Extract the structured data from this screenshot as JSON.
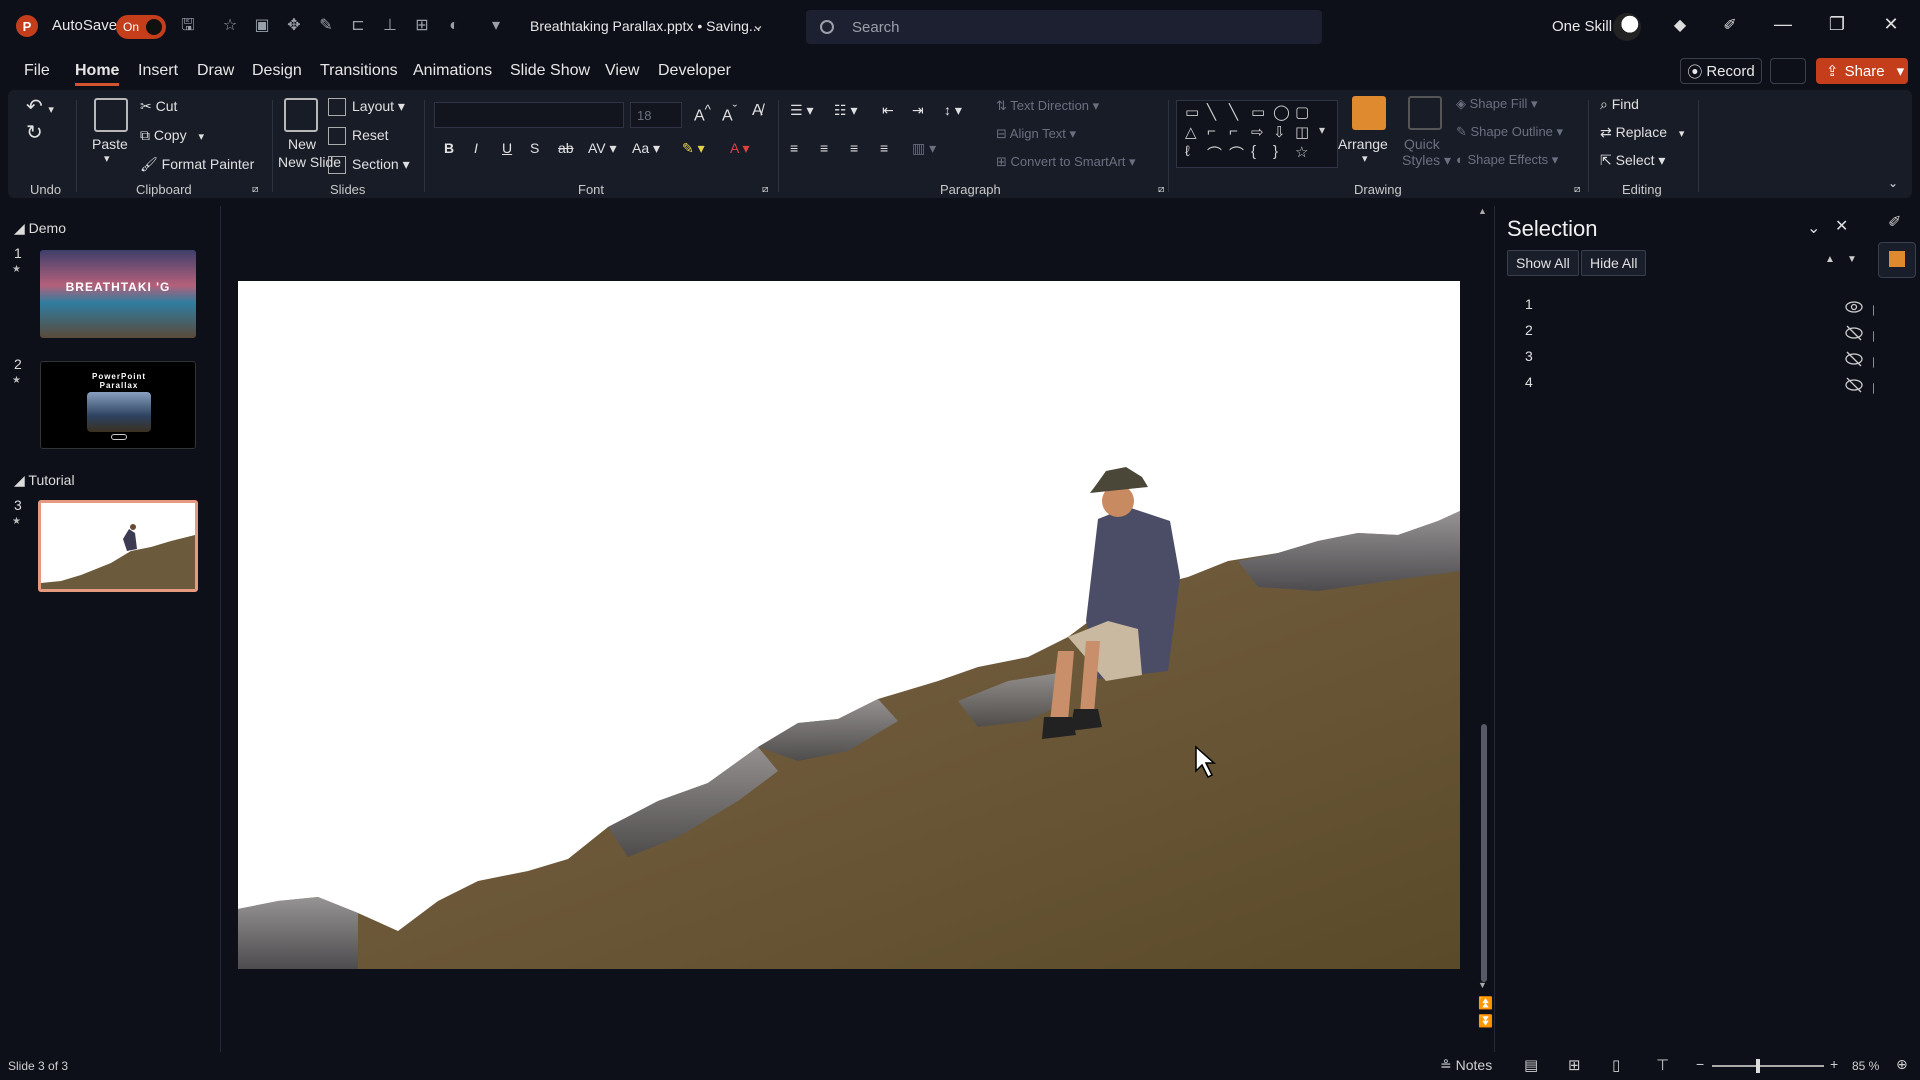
{
  "titlebar": {
    "autosave_label": "AutoSave",
    "autosave_state": "On",
    "doc_title": "Breathtaking Parallax.pptx • Saving...",
    "search_placeholder": "Search",
    "user_name": "One Skill"
  },
  "menu": {
    "tabs": [
      "File",
      "Home",
      "Insert",
      "Draw",
      "Design",
      "Transitions",
      "Animations",
      "Slide Show",
      "View",
      "Developer"
    ],
    "active": "Home",
    "record_label": "Record",
    "share_label": "Share"
  },
  "ribbon": {
    "undo_group": "Undo",
    "clipboard": {
      "label": "Clipboard",
      "paste": "Paste",
      "cut": "Cut",
      "copy": "Copy",
      "format_painter": "Format Painter"
    },
    "slides": {
      "label": "Slides",
      "new_slide": "New Slide",
      "layout": "Layout",
      "reset": "Reset",
      "section": "Section"
    },
    "font": {
      "label": "Font",
      "size": "18"
    },
    "paragraph": {
      "label": "Paragraph",
      "text_direction": "Text Direction",
      "align_text": "Align Text",
      "convert_smartart": "Convert to SmartArt"
    },
    "drawing": {
      "label": "Drawing",
      "arrange": "Arrange",
      "quick_styles": "Quick Styles",
      "shape_fill": "Shape Fill",
      "shape_outline": "Shape Outline",
      "shape_effects": "Shape Effects"
    },
    "editing": {
      "label": "Editing",
      "find": "Find",
      "replace": "Replace",
      "select": "Select"
    }
  },
  "thumbnails": {
    "sections": [
      "Demo",
      "Tutorial"
    ],
    "slides": [
      {
        "num": "1",
        "text": "BREATHTAKI 'G"
      },
      {
        "num": "2",
        "text": "PowerPoint Parallax"
      },
      {
        "num": "3",
        "text": ""
      }
    ]
  },
  "selection_pane": {
    "title": "Selection",
    "show_all": "Show All",
    "hide_all": "Hide All",
    "items": [
      {
        "name": "1",
        "visible": true
      },
      {
        "name": "2",
        "visible": false
      },
      {
        "name": "3",
        "visible": false
      },
      {
        "name": "4",
        "visible": false
      }
    ]
  },
  "status": {
    "slide_info": "Slide 3 of 3",
    "notes": "Notes",
    "zoom": "85 %"
  }
}
